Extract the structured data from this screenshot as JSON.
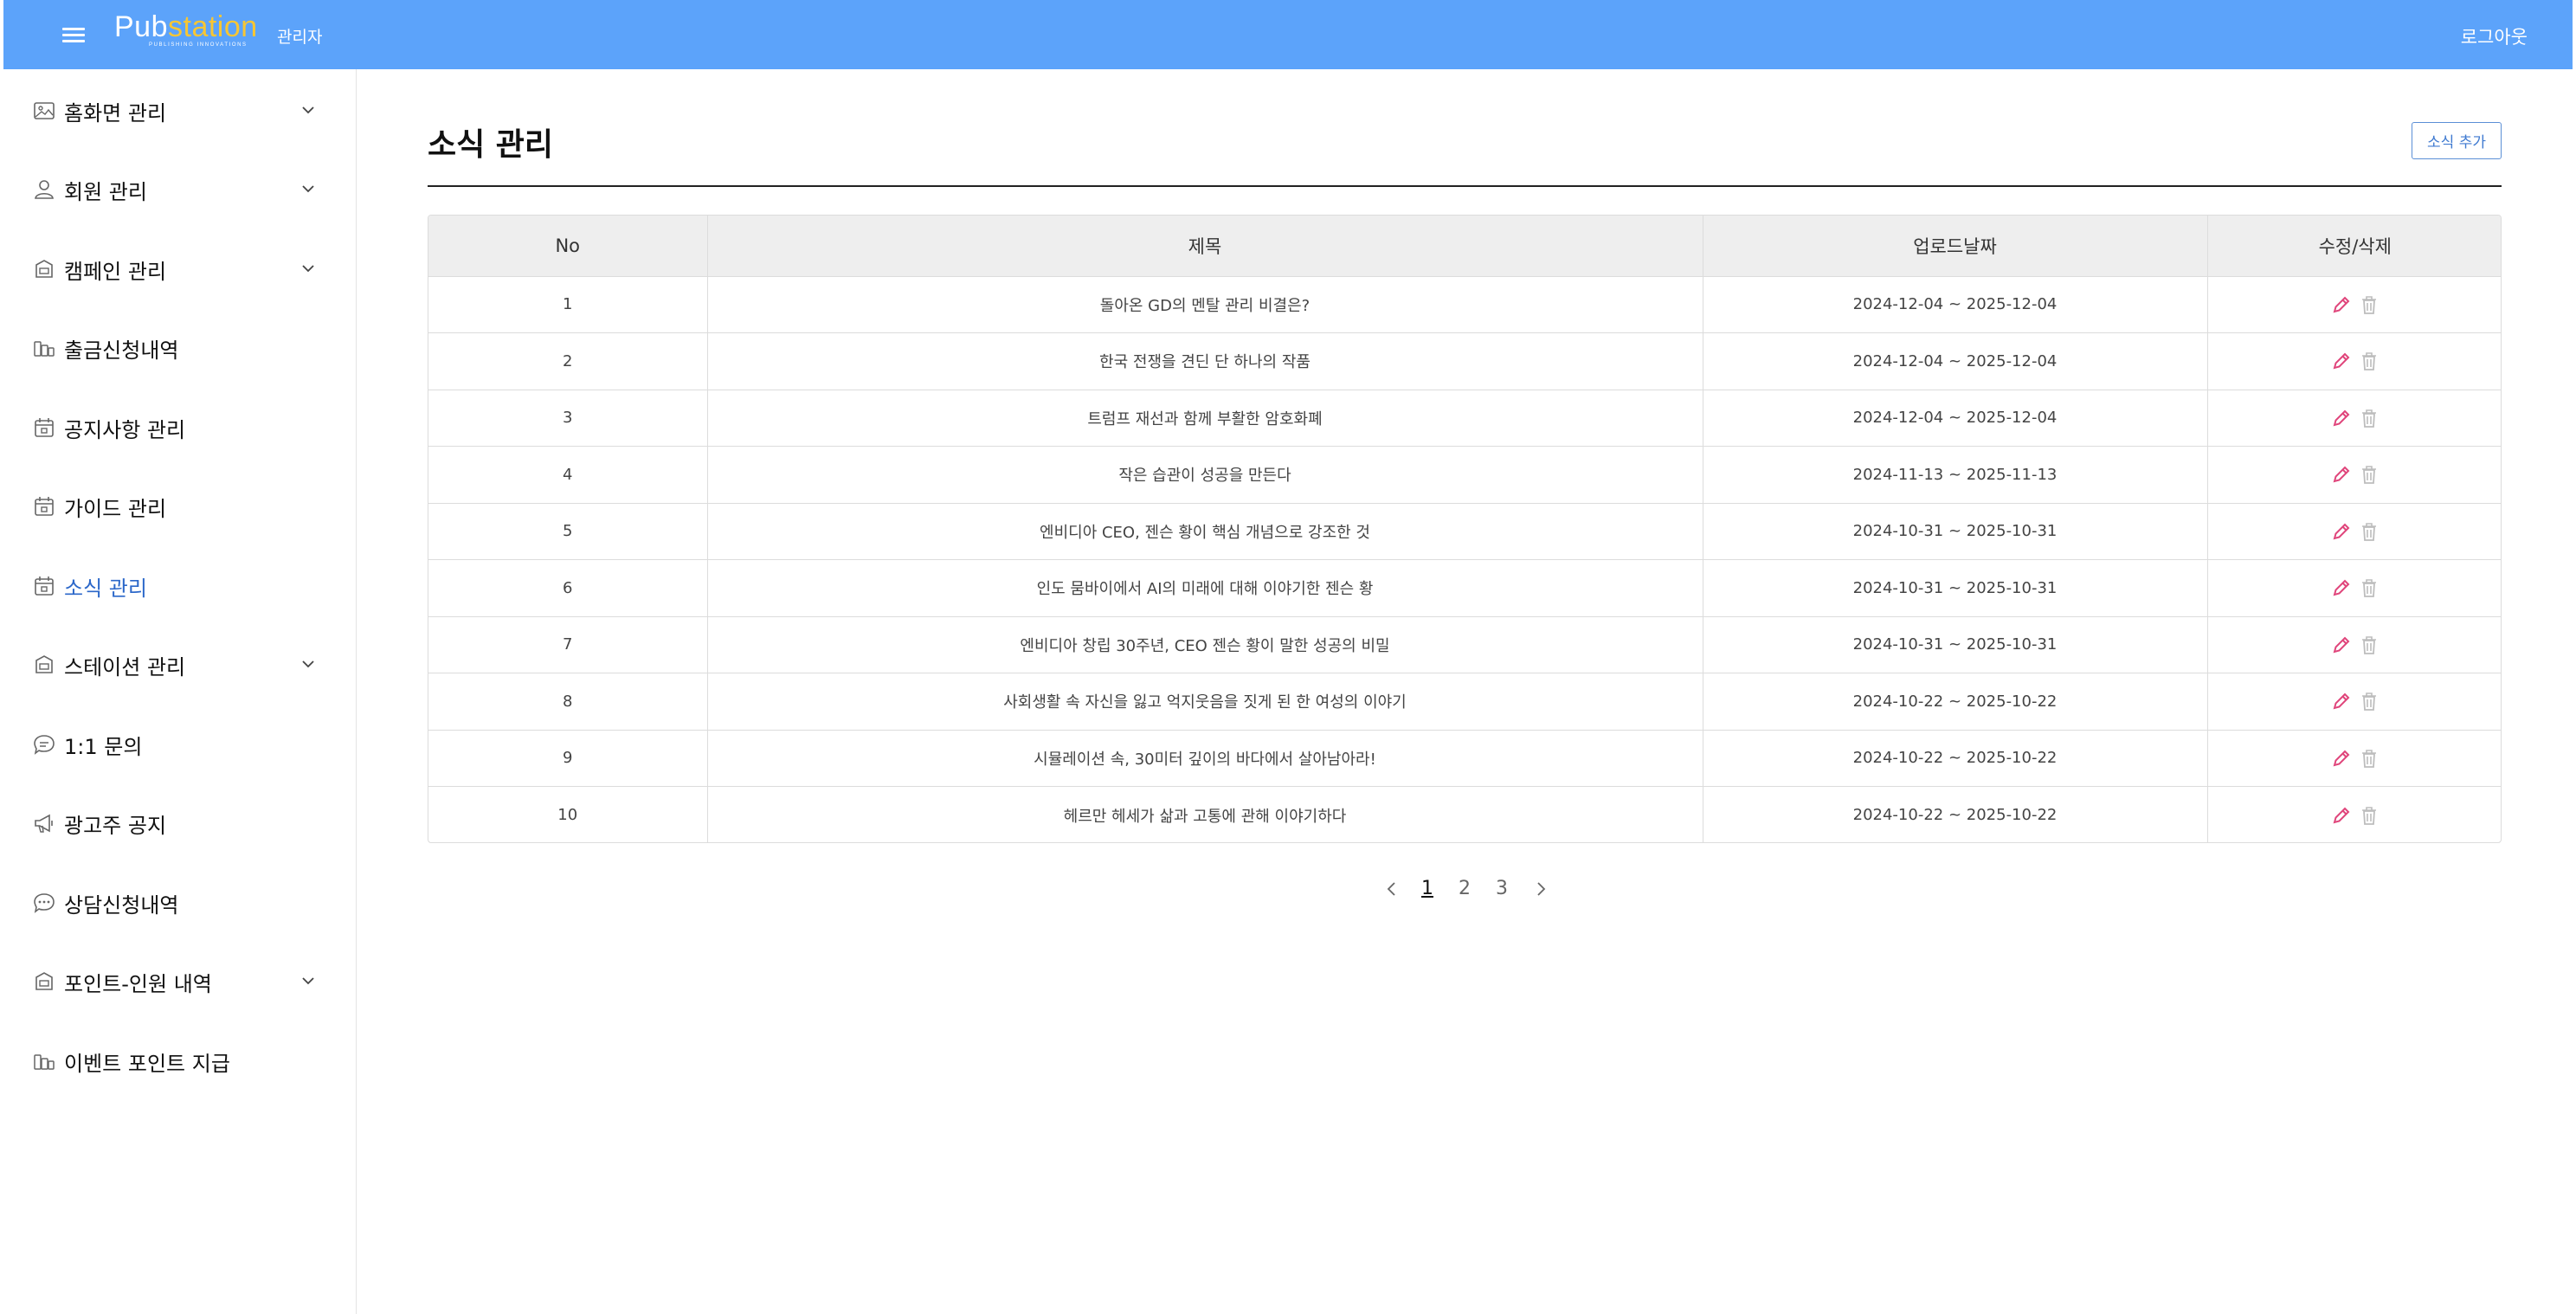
{
  "header": {
    "logo_main": "Pub",
    "logo_accent": "station",
    "logo_tagline": "PUBLISHING INNOVATIONS",
    "admin_label": "관리자",
    "logout_label": "로그아웃"
  },
  "sidebar": {
    "items": [
      {
        "label": "홈화면 관리",
        "icon": "image-icon",
        "expandable": true
      },
      {
        "label": "회원 관리",
        "icon": "user-icon",
        "expandable": true
      },
      {
        "label": "캠페인 관리",
        "icon": "box-icon",
        "expandable": true
      },
      {
        "label": "출금신청내역",
        "icon": "coins-icon",
        "expandable": false
      },
      {
        "label": "공지사항 관리",
        "icon": "calendar-icon",
        "expandable": false
      },
      {
        "label": "가이드 관리",
        "icon": "calendar-icon",
        "expandable": false
      },
      {
        "label": "소식 관리",
        "icon": "calendar-icon",
        "expandable": false,
        "active": true
      },
      {
        "label": "스테이션 관리",
        "icon": "box-icon",
        "expandable": true
      },
      {
        "label": "1:1 문의",
        "icon": "chat-icon",
        "expandable": false
      },
      {
        "label": "광고주 공지",
        "icon": "megaphone-icon",
        "expandable": false
      },
      {
        "label": "상담신청내역",
        "icon": "chat-dots-icon",
        "expandable": false
      },
      {
        "label": "포인트-인원 내역",
        "icon": "box-icon",
        "expandable": true
      },
      {
        "label": "이벤트 포인트 지급",
        "icon": "coins-icon",
        "expandable": false
      }
    ],
    "active_color": "#2b67c9"
  },
  "main": {
    "title": "소식 관리",
    "add_button": "소식 추가",
    "table": {
      "columns": [
        "No",
        "제목",
        "업로드날짜",
        "수정/삭제"
      ],
      "rows": [
        {
          "no": "1",
          "title": "돌아온 GD의 멘탈 관리 비결은?",
          "date": "2024-12-04 ~ 2025-12-04"
        },
        {
          "no": "2",
          "title": "한국 전쟁을 견딘 단 하나의 작품",
          "date": "2024-12-04 ~ 2025-12-04"
        },
        {
          "no": "3",
          "title": "트럼프 재선과 함께 부활한 암호화폐",
          "date": "2024-12-04 ~ 2025-12-04"
        },
        {
          "no": "4",
          "title": "작은 습관이 성공을 만든다",
          "date": "2024-11-13 ~ 2025-11-13"
        },
        {
          "no": "5",
          "title": "엔비디아 CEO, 젠슨 황이 핵심 개념으로 강조한 것",
          "date": "2024-10-31 ~ 2025-10-31"
        },
        {
          "no": "6",
          "title": "인도 뭄바이에서 AI의 미래에 대해 이야기한 젠슨 황",
          "date": "2024-10-31 ~ 2025-10-31"
        },
        {
          "no": "7",
          "title": "엔비디아 창립 30주년, CEO 젠슨 황이 말한 성공의 비밀",
          "date": "2024-10-31 ~ 2025-10-31"
        },
        {
          "no": "8",
          "title": "사회생활 속 자신을 잃고 억지웃음을 짓게 된 한 여성의 이야기",
          "date": "2024-10-22 ~ 2025-10-22"
        },
        {
          "no": "9",
          "title": "시뮬레이션 속, 30미터 깊이의 바다에서 살아남아라!",
          "date": "2024-10-22 ~ 2025-10-22"
        },
        {
          "no": "10",
          "title": "헤르만 헤세가 삶과 고통에 관해 이야기하다",
          "date": "2024-10-22 ~ 2025-10-22"
        }
      ],
      "edit_icon": "pencil-icon",
      "delete_icon": "trash-icon",
      "edit_color": "#e0457b",
      "delete_color": "#bdbdbd"
    },
    "pagination": {
      "pages": [
        "1",
        "2",
        "3"
      ],
      "current": "1"
    }
  },
  "colors": {
    "header_bg": "#5ca3fa",
    "logo_accent": "#f7c634",
    "button_border": "#5b8fd6"
  }
}
